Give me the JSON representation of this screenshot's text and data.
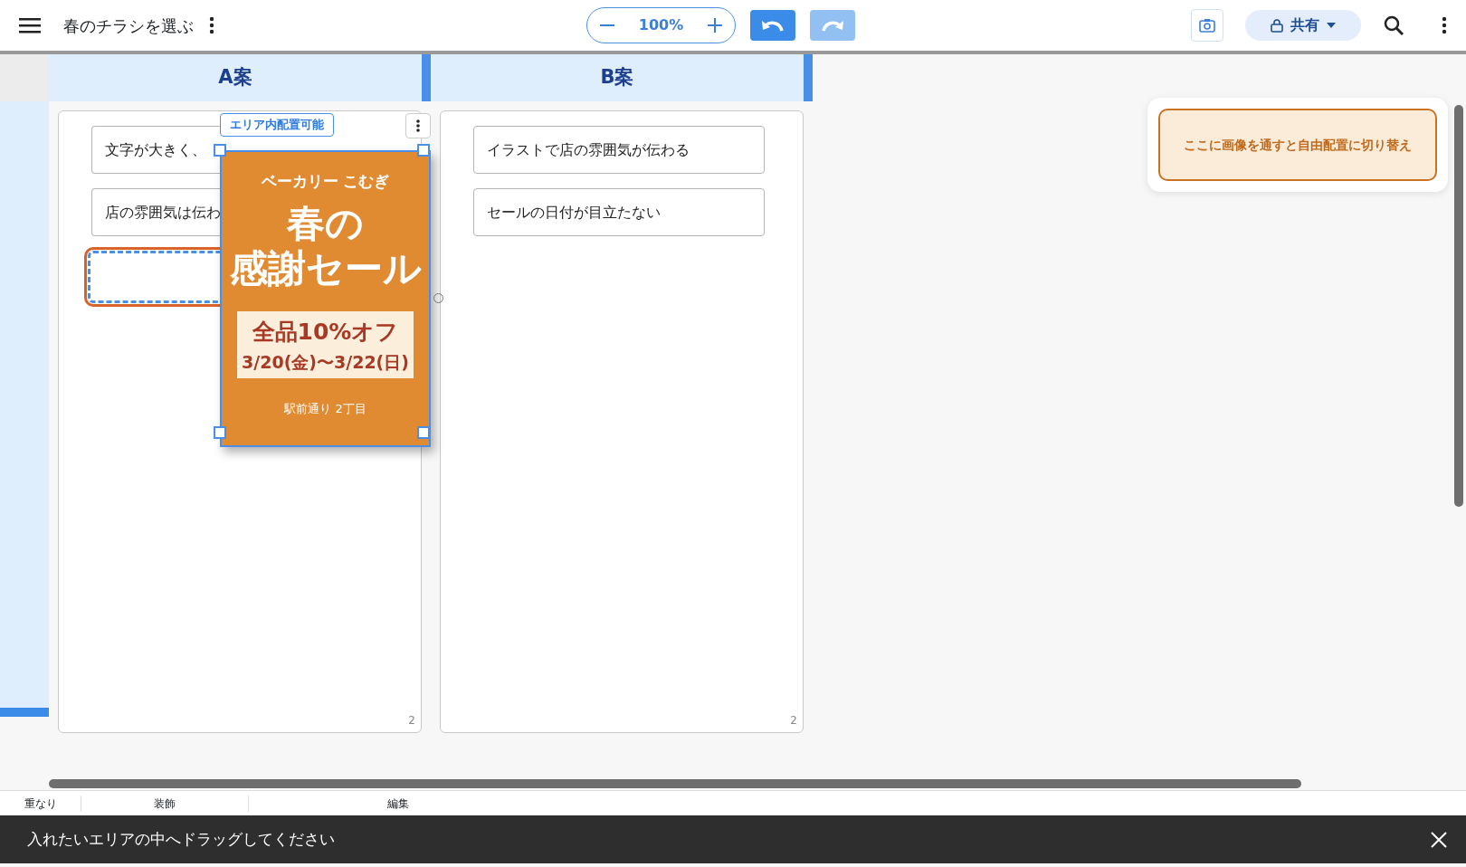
{
  "app_bar": {
    "title": "春のチラシを選ぶ",
    "zoom": "100%",
    "redo_disabled": true,
    "share": "共有"
  },
  "columns": [
    {
      "title": "A案",
      "count": "2",
      "notes": [
        "文字が大きく、",
        "店の雰囲気は伝わ"
      ],
      "drop_target": true
    },
    {
      "title": "B案",
      "count": "2",
      "notes": [
        "イラストで店の雰囲気が伝わる",
        "セールの日付が目立たない"
      ],
      "drop_target": false
    }
  ],
  "dragged_flyer": {
    "badge": "エリア内配置可能",
    "shop": "ベーカリー こむぎ",
    "headline_1": "春の",
    "headline_2": "感謝セール",
    "offer": "全品10%オフ",
    "dates": "3/20(金)〜3/22(日)",
    "address": "駅前通り 2丁目"
  },
  "free_zone": {
    "label": "ここに画像を通すと自由配置に切り替え"
  },
  "bottom_tabs": [
    "重なり",
    "装飾",
    "編集"
  ],
  "snackbar": {
    "message": "入れたいエリアの中へドラッグしてください"
  }
}
